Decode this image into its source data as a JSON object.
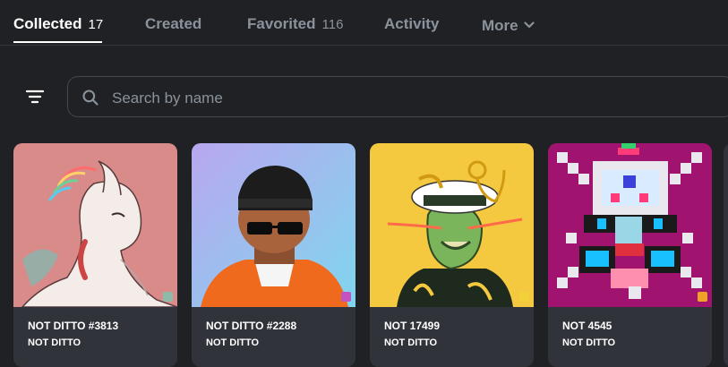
{
  "tabs": [
    {
      "label": "Collected",
      "count": "17"
    },
    {
      "label": "Created",
      "count": ""
    },
    {
      "label": "Favorited",
      "count": "116"
    },
    {
      "label": "Activity",
      "count": ""
    },
    {
      "label": "More",
      "count": ""
    }
  ],
  "search": {
    "placeholder": "Search by name",
    "value": ""
  },
  "icons": {
    "filter": "filter-lines-icon",
    "search": "search-icon",
    "more": "chevron-down-icon"
  },
  "colors": {
    "background": "#202125",
    "card": "#303339",
    "muted_text": "#8a939b",
    "border": "#45474d"
  },
  "items": [
    {
      "name": "NOT DITTO #3813",
      "collection": "NOT DITTO"
    },
    {
      "name": "NOT DITTO #2288",
      "collection": "NOT DITTO"
    },
    {
      "name": "NOT 17499",
      "collection": "NOT DITTO"
    },
    {
      "name": "NOT 4545",
      "collection": "NOT DITTO"
    }
  ]
}
